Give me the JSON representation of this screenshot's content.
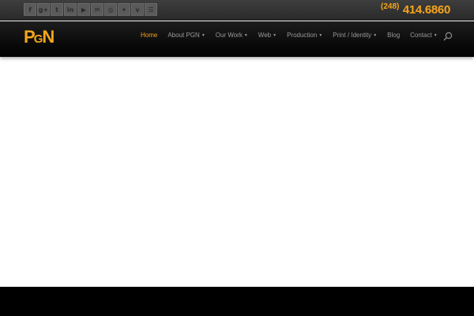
{
  "topbar": {
    "social_icons": [
      {
        "name": "facebook-icon",
        "glyph": "f"
      },
      {
        "name": "google-plus-icon",
        "glyph": "g+"
      },
      {
        "name": "twitter-icon",
        "glyph": "t"
      },
      {
        "name": "linkedin-icon",
        "glyph": "in"
      },
      {
        "name": "youtube-icon",
        "glyph": "▶"
      },
      {
        "name": "email-icon",
        "glyph": "✉"
      },
      {
        "name": "dribbble-icon",
        "glyph": "◎"
      },
      {
        "name": "pinterest-icon",
        "glyph": "✦"
      },
      {
        "name": "vimeo-icon",
        "glyph": "v"
      },
      {
        "name": "rss-icon",
        "glyph": "☰"
      }
    ],
    "phone": {
      "area": "(248)",
      "number": "414.6860"
    }
  },
  "navbar": {
    "logo": {
      "p": "P",
      "g": "G",
      "n": "N"
    },
    "menu": [
      {
        "label": "Home",
        "active": true,
        "has_dropdown": false
      },
      {
        "label": "About PGN",
        "active": false,
        "has_dropdown": true
      },
      {
        "label": "Our Work",
        "active": false,
        "has_dropdown": true
      },
      {
        "label": "Web",
        "active": false,
        "has_dropdown": true
      },
      {
        "label": "Production",
        "active": false,
        "has_dropdown": true
      },
      {
        "label": "Print / Identity",
        "active": false,
        "has_dropdown": true
      },
      {
        "label": "Blog",
        "active": false,
        "has_dropdown": false
      },
      {
        "label": "Contact",
        "active": false,
        "has_dropdown": true
      }
    ],
    "caret": "▼"
  },
  "colors": {
    "accent": "#f7a51a",
    "nav_bg": "#000000",
    "topbar_bg": "#333333"
  }
}
